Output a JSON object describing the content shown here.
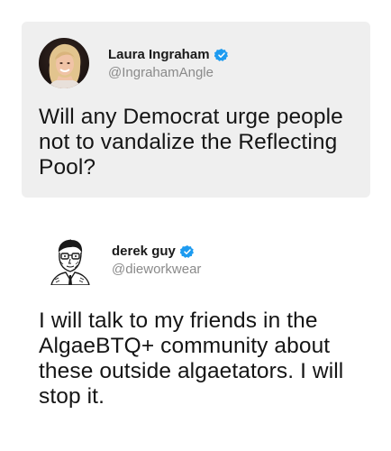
{
  "tweets": [
    {
      "name": "Laura Ingraham",
      "handle": "@IngrahamAngle",
      "text": "Will any Democrat urge people not to vandalize the Reflecting Pool?",
      "verified": true,
      "avatar_icon": "portrait-photo-icon"
    },
    {
      "name": "derek guy",
      "handle": "@dieworkwear",
      "text": "I will talk to my friends in the AlgaeBTQ+ community about these outside algaetators. I will stop it.",
      "verified": true,
      "avatar_icon": "sketch-portrait-icon"
    }
  ],
  "colors": {
    "card_background": "#efefef",
    "verified_blue": "#1d9bf0",
    "handle_gray": "#8a8a8a"
  }
}
